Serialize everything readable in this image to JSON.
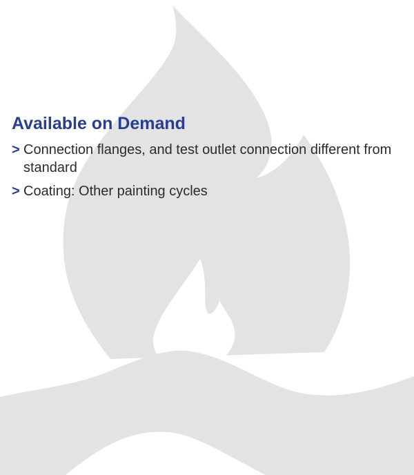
{
  "section": {
    "title": "Available on Demand",
    "bullet_symbol": ">",
    "items": [
      {
        "text": "Connection flanges, and test outlet connection different from standard"
      },
      {
        "text": "Coating: Other painting cycles"
      }
    ]
  },
  "colors": {
    "heading": "#2a3d8f",
    "bullet": "#2a3d8f",
    "body_text": "#2b2b2b",
    "background_graphic": "#e3e3e3",
    "background": "#ffffff"
  },
  "icons": {
    "background": "flame-icon"
  }
}
